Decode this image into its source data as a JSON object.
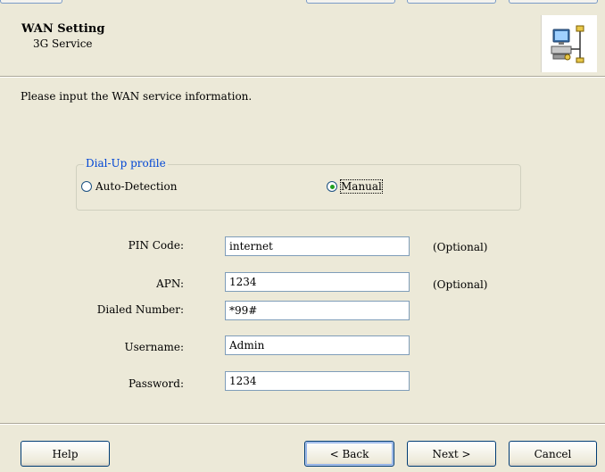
{
  "header": {
    "title": "WAN Setting",
    "subtitle": "3G Service",
    "icon": "network-computer-icon"
  },
  "intro": "Please input the WAN service information.",
  "dialup": {
    "legend": "Dial-Up profile",
    "options": [
      {
        "label": "Auto-Detection",
        "selected": false
      },
      {
        "label": "Manual",
        "selected": true
      }
    ]
  },
  "fields": {
    "pin": {
      "label": "PIN Code:",
      "value": "internet",
      "note": "(Optional)"
    },
    "apn": {
      "label": "APN:",
      "value": "1234",
      "note": "(Optional)"
    },
    "dialed": {
      "label": "Dialed Number:",
      "value": "*99#"
    },
    "username": {
      "label": "Username:",
      "value": "Admin"
    },
    "password": {
      "label": "Password:",
      "value": "1234"
    }
  },
  "buttons": {
    "help": "Help",
    "back": "< Back",
    "next": "Next >",
    "cancel": "Cancel"
  },
  "colors": {
    "background": "#ece9d8",
    "legend": "#0046d5",
    "radio_dot": "#21a121",
    "button_border": "#003c74"
  }
}
